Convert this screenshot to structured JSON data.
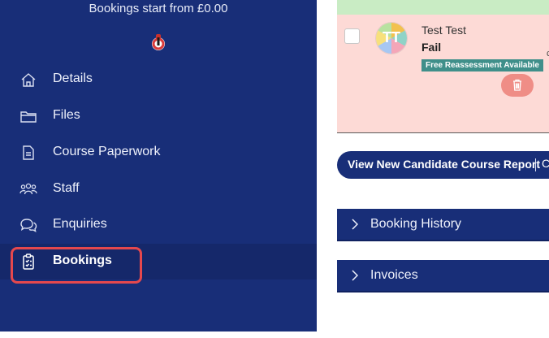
{
  "sidebar": {
    "price_note": "Bookings start from £0.00",
    "items": [
      {
        "label": "Details",
        "icon": "home-icon"
      },
      {
        "label": "Files",
        "icon": "folder-icon"
      },
      {
        "label": "Course Paperwork",
        "icon": "document-icon"
      },
      {
        "label": "Staff",
        "icon": "people-icon"
      },
      {
        "label": "Enquiries",
        "icon": "chat-bubbles-icon"
      },
      {
        "label": "Bookings",
        "icon": "clipboard-icon",
        "active": true
      }
    ]
  },
  "candidate": {
    "avatar_initials": "TT",
    "name": "Test Test",
    "status": "Fail",
    "badge": "Free Reassessment Available"
  },
  "actions": {
    "report_button": "View New Candidate Course Report",
    "report_more_glyph": "C",
    "cut_glyph": "c"
  },
  "accordions": [
    {
      "label": "Booking History"
    },
    {
      "label": "Invoices"
    }
  ],
  "colors": {
    "sidebar_bg": "#182e78",
    "fail_card_bg": "#fddad6",
    "pass_bar_bg": "#c9ecc4",
    "badge_bg": "#3f8f8a",
    "highlight": "#e5484d"
  }
}
